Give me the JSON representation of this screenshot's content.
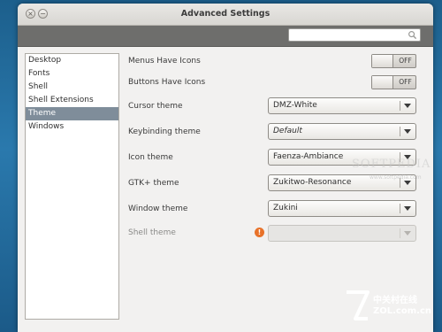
{
  "window": {
    "title": "Advanced Settings",
    "close_glyph": "×",
    "minimize_glyph": "−"
  },
  "search": {
    "value": "",
    "placeholder": "",
    "icon": "search-icon"
  },
  "sidebar": {
    "items": [
      {
        "label": "Desktop",
        "selected": false
      },
      {
        "label": "Fonts",
        "selected": false
      },
      {
        "label": "Shell",
        "selected": false
      },
      {
        "label": "Shell Extensions",
        "selected": false
      },
      {
        "label": "Theme",
        "selected": true
      },
      {
        "label": "Windows",
        "selected": false
      }
    ]
  },
  "settings": {
    "menus_have_icons": {
      "label": "Menus Have Icons",
      "state": "OFF"
    },
    "buttons_have_icons": {
      "label": "Buttons Have Icons",
      "state": "OFF"
    },
    "cursor_theme": {
      "label": "Cursor theme",
      "value": "DMZ-White"
    },
    "keybinding_theme": {
      "label": "Keybinding theme",
      "value": "Default"
    },
    "icon_theme": {
      "label": "Icon theme",
      "value": "Faenza-Ambiance"
    },
    "gtk_theme": {
      "label": "GTK+ theme",
      "value": "Zukitwo-Resonance"
    },
    "window_theme": {
      "label": "Window theme",
      "value": "Zukini"
    },
    "shell_theme": {
      "label": "Shell theme",
      "value": "",
      "warning_glyph": "!"
    }
  },
  "watermarks": {
    "softpedia": "SOFTPEDIA",
    "softpedia_url": "www.softpedia.com",
    "zol_cn": "中关村在线",
    "zol_url": "ZOL.com.cn"
  },
  "colors": {
    "selected_row": "#7f8d9a",
    "toolbar": "#6e6e6c",
    "warning": "#e8722a",
    "desktop": "#2a79ad"
  }
}
